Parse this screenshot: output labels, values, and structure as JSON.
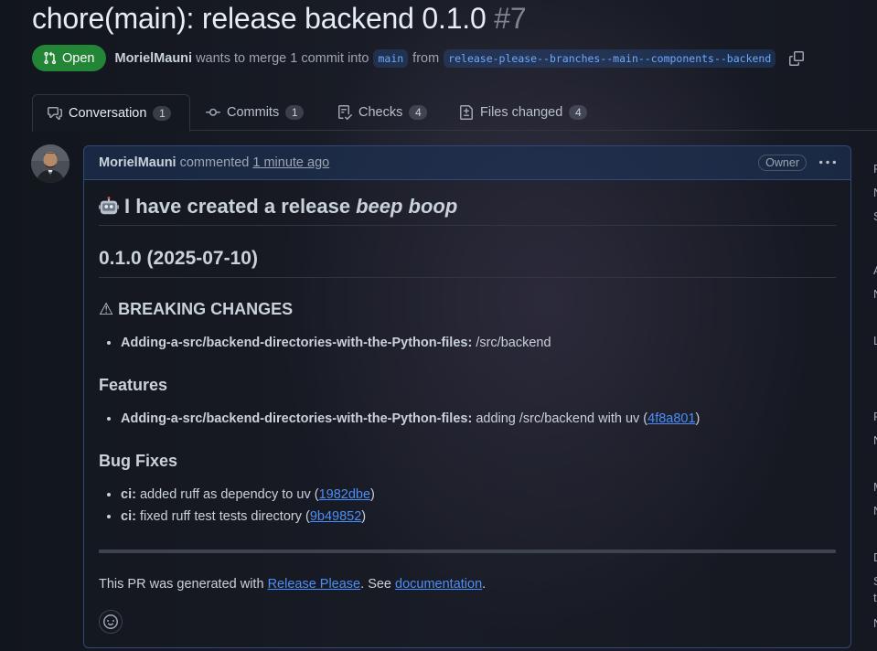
{
  "pr": {
    "title": "chore(main): release backend 0.1.0",
    "number": "#7",
    "state": "Open",
    "author": "MorielMauni",
    "merge_text": "wants to merge 1 commit into",
    "base_branch": "main",
    "from_text": "from",
    "head_branch": "release-please--branches--main--components--backend"
  },
  "tabs": [
    {
      "label": "Conversation",
      "count": "1",
      "icon": "comment-discussion-icon"
    },
    {
      "label": "Commits",
      "count": "1",
      "icon": "commit-icon"
    },
    {
      "label": "Checks",
      "count": "4",
      "icon": "checklist-icon"
    },
    {
      "label": "Files changed",
      "count": "4",
      "icon": "file-diff-icon"
    }
  ],
  "comment": {
    "author": "MorielMauni",
    "action": "commented",
    "time": "1 minute ago",
    "role": "Owner",
    "heading_prefix": "I have created a release",
    "heading_em": "beep boop",
    "version_heading": "0.1.0 (2025-07-10)",
    "breaking_heading": "⚠ BREAKING CHANGES",
    "breaking_items": [
      {
        "scope": "Adding-a-src/backend-directories-with-the-Python-files:",
        "text": " /src/backend"
      }
    ],
    "features_heading": "Features",
    "feature_items": [
      {
        "scope": "Adding-a-src/backend-directories-with-the-Python-files:",
        "text": " adding /src/backend with uv (",
        "hash": "4f8a801",
        "tail": ")"
      }
    ],
    "bugfix_heading": "Bug Fixes",
    "bugfix_items": [
      {
        "scope": "ci:",
        "text": " added ruff as dependcy to uv (",
        "hash": "1982dbe",
        "tail": ")"
      },
      {
        "scope": "ci:",
        "text": " fixed ruff test tests directory (",
        "hash": "9b49852",
        "tail": ")"
      }
    ],
    "footer_prefix": "This PR was generated with ",
    "footer_link1": "Release Please",
    "footer_mid": ". See ",
    "footer_link2": "documentation",
    "footer_suffix": "."
  },
  "sidebar_glyphs": [
    "R",
    "N",
    "S",
    "A",
    "N",
    "L",
    "P",
    "N",
    "M",
    "N",
    "D",
    "S",
    "t",
    "N"
  ],
  "colors": {
    "open_badge": "#238636",
    "link": "#4c8ef7",
    "background": "#0d1117"
  }
}
